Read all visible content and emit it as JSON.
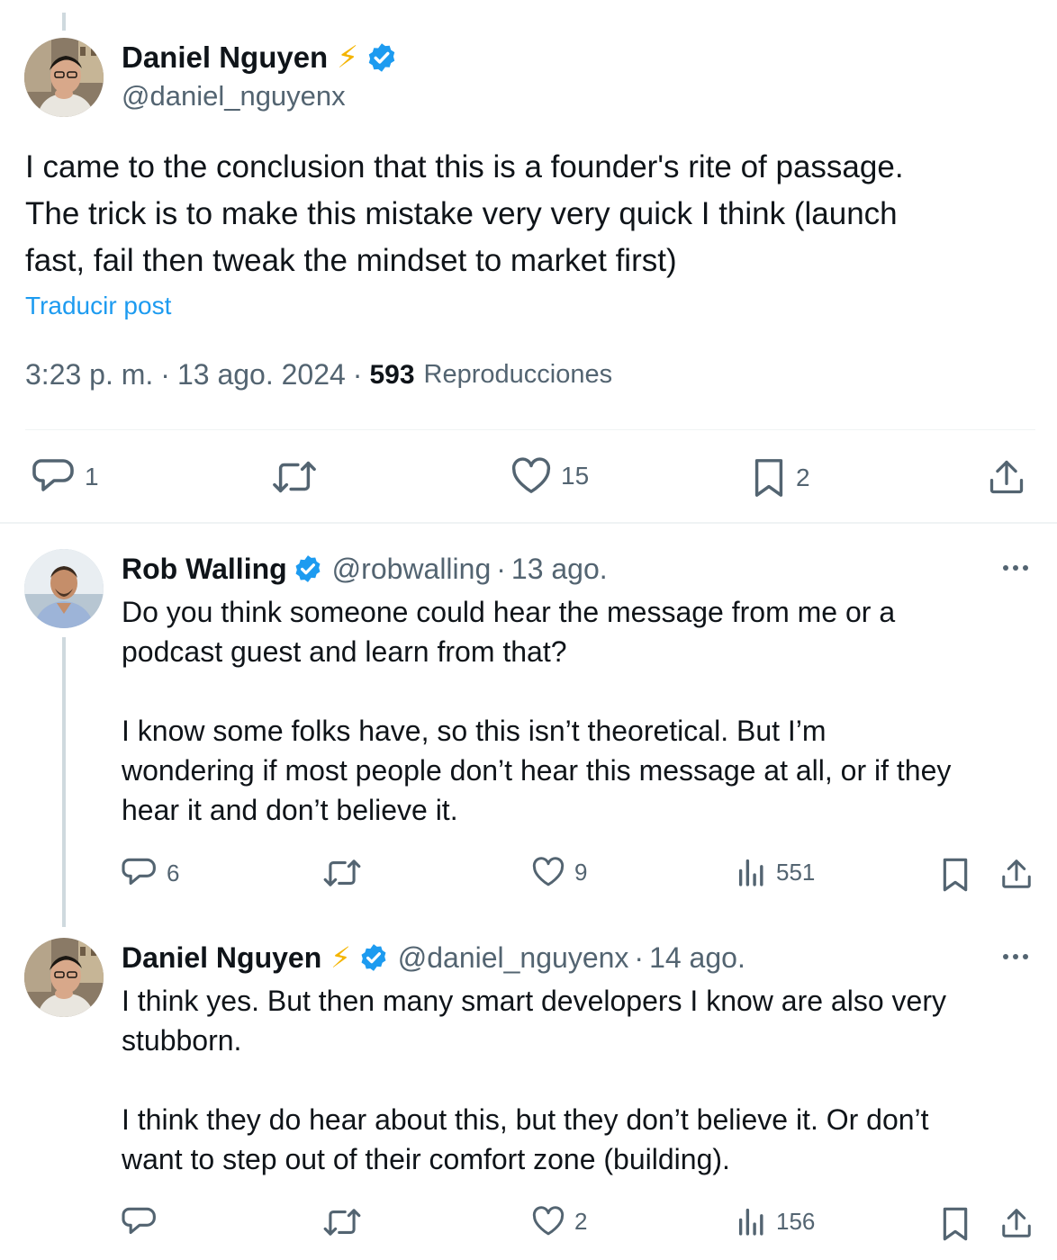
{
  "main_post": {
    "author_name": "Daniel Nguyen",
    "author_emoji": "⚡",
    "handle": "@daniel_nguyenx",
    "text_lines": [
      "I came to the conclusion that this is a founder's rite of passage.",
      "The trick is to make this mistake very very quick I think (launch",
      "fast, fail then tweak the mindset to market first)"
    ],
    "translate_label": "Traducir post",
    "time": "3:23 p. m.",
    "sep": "·",
    "date": "13 ago. 2024",
    "views_count": "593",
    "views_label": "Reproducciones",
    "actions": {
      "replies": "1",
      "likes": "15",
      "bookmarks": "2"
    }
  },
  "replies": [
    {
      "author_name": "Rob Walling",
      "handle": "@robwalling",
      "sep": "·",
      "date": "13 ago.",
      "paragraphs": [
        [
          "Do you think someone could hear the message from me or a",
          "podcast guest and learn from that?"
        ],
        [
          "I know some folks have, so this isn’t theoretical. But I’m",
          "wondering if most people don’t hear this message at all, or if they",
          "hear it and don’t believe it."
        ]
      ],
      "actions": {
        "replies": "6",
        "likes": "9",
        "views": "551"
      }
    },
    {
      "author_name": "Daniel Nguyen",
      "author_emoji": "⚡",
      "handle": "@daniel_nguyenx",
      "sep": "·",
      "date": "14 ago.",
      "paragraphs": [
        [
          "I think yes. But then many smart developers I know are also very",
          "stubborn."
        ],
        [
          "I think they do hear about this, but they don’t believe it. Or don’t",
          "want to step out of their comfort zone (building)."
        ]
      ],
      "actions": {
        "replies": "",
        "likes": "2",
        "views": "156"
      }
    }
  ],
  "colors": {
    "text": "#0f1419",
    "muted": "#536471",
    "link": "#1d9bf0",
    "verified": "#1d9bf0",
    "divider": "#eff3f4",
    "thread_line": "#cfd9de",
    "emoji_lightning": "#f4b400"
  },
  "icons": [
    "verified-badge-icon",
    "lightning-emoji-icon",
    "reply-icon",
    "retweet-icon",
    "like-icon",
    "bookmark-icon",
    "share-icon",
    "views-icon",
    "more-icon"
  ]
}
